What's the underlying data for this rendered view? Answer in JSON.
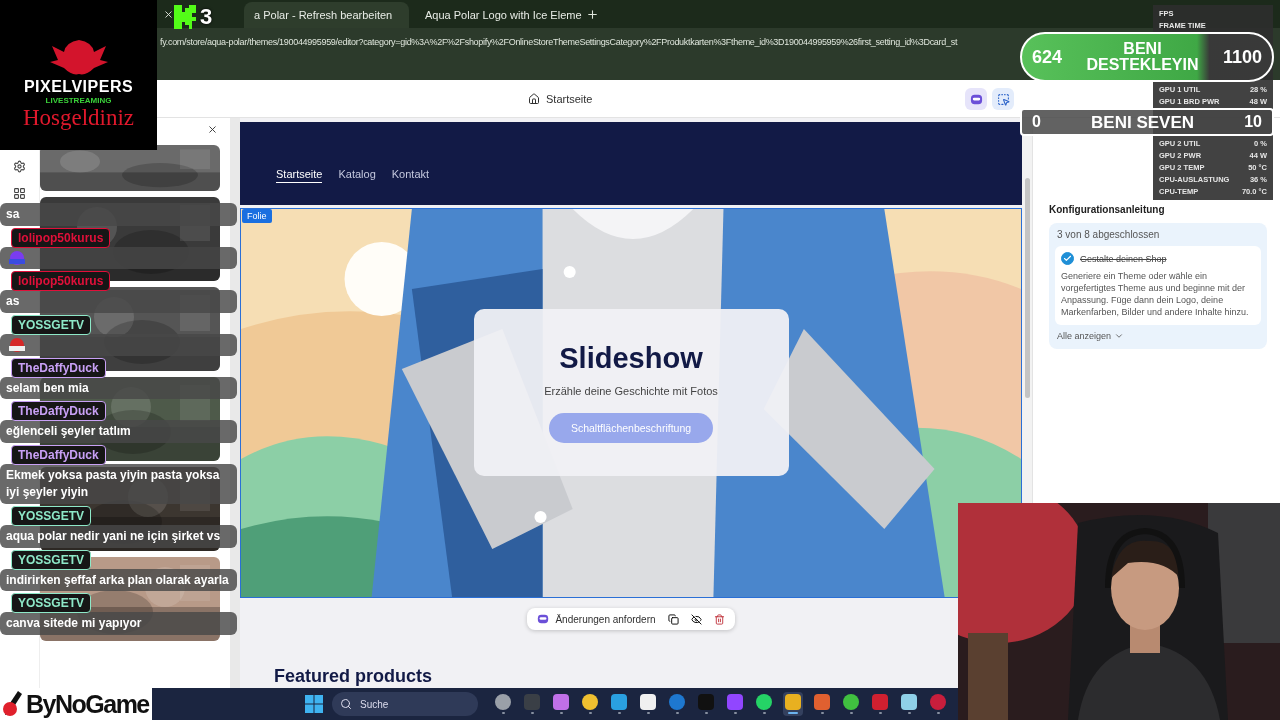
{
  "stream_logo": {
    "title": "PIXELVIPERS",
    "subtitle": "LIVESTREAMING",
    "greeting": "Hosgeldiniz"
  },
  "kick_badge": {
    "count": "3"
  },
  "browser": {
    "tabs": [
      {
        "title": "a Polar - Refresh bearbeiten",
        "selected": true
      },
      {
        "title": "Aqua Polar Logo with Ice Eleme",
        "selected": false
      }
    ],
    "url": "fy.com/store/aqua-polar/themes/190044995959/editor?category=gid%3A%2F%2Fshopify%2FOnlineStoreThemeSettingsCategory%2FProduktkarten%3Ftheme_id%3D190044995959%26first_setting_id%3Dcard_st"
  },
  "editor": {
    "page": "Startseite"
  },
  "preview": {
    "nav": [
      {
        "label": "Startseite",
        "selected": true
      },
      {
        "label": "Katalog",
        "selected": false
      },
      {
        "label": "Kontakt",
        "selected": false
      }
    ],
    "section_tag": "Folie",
    "slide": {
      "title": "Slideshow",
      "text": "Erzähle deine Geschichte mit Fotos",
      "button": "Schaltflächenbeschriftung"
    },
    "toolbar": {
      "label": "Änderungen anfordern"
    },
    "next_section": "Featured products"
  },
  "guide": {
    "title": "Konfigurationsanleitung",
    "progress": "3 von 8 abgeschlossen",
    "steps": [
      {
        "label": "Gestalte deinen Shop",
        "checked": true,
        "description": "Generiere ein Theme oder wähle ein vorgefertigtes Theme aus und beginne mit der Anpassung. Füge dann dein Logo, deine Markenfarben, Bilder und andere Inhalte hinzu."
      }
    ],
    "show_all": "Alle anzeigen"
  },
  "perf": [
    {
      "label": "FPS"
    },
    {
      "label": "FRAME TIME"
    },
    {
      "label": "GPU 1 UTIL",
      "value": "28 %"
    },
    {
      "label": "GPU 1 BRD PWR",
      "value": "48 W"
    },
    {
      "label": "GPU 2 UTIL",
      "value": "0 %"
    },
    {
      "label": "GPU 2 PWR",
      "value": "44 W"
    },
    {
      "label": "GPU 2 TEMP",
      "value": "50 °C"
    },
    {
      "label": "CPU-AUSLASTUNG",
      "value": "36 %"
    },
    {
      "label": "CPU-TEMP",
      "value": "70.0 °C"
    }
  ],
  "likes": {
    "count": "624",
    "label": "BENI DESTEKLEYIN",
    "goal": "1100"
  },
  "loves": {
    "count": "0",
    "label": "BENI SEVEN",
    "goal": "10"
  },
  "chat": [
    {
      "kind": "text",
      "text": "sa"
    },
    {
      "kind": "emote",
      "user": "lolipop50kurus",
      "color": "#e0103a"
    },
    {
      "kind": "text",
      "user": "lolipop50kurus",
      "color": "#e0103a",
      "text": "as"
    },
    {
      "kind": "emote",
      "user": "YOSSGETV",
      "color": "#8ee8c8"
    },
    {
      "kind": "text",
      "user": "TheDaffyDuck",
      "color": "#c8a0f5",
      "text": "selam ben mia"
    },
    {
      "kind": "text",
      "user": "TheDaffyDuck",
      "color": "#c8a0f5",
      "text": "eğlenceli şeyler tatlım"
    },
    {
      "kind": "text",
      "user": "TheDaffyDuck",
      "color": "#c8a0f5",
      "text": "Ekmek yoksa pasta yiyin pasta yoksa iyi şeyler yiyin"
    },
    {
      "kind": "text",
      "user": "YOSSGETV",
      "color": "#8ee8c8",
      "text": "aqua polar nedir yani ne için şirket vs"
    },
    {
      "kind": "text",
      "user": "YOSSGETV",
      "color": "#8ee8c8",
      "text": "indirirken şeffaf arka plan olarak ayarla"
    },
    {
      "kind": "text",
      "user": "YOSSGETV",
      "color": "#8ee8c8",
      "text": "canva sitede mi yapıyor"
    }
  ],
  "sponsor": {
    "name": "ByNoGame"
  },
  "taskbar": {
    "search": "Suche",
    "apps": [
      {
        "color": "#9aa0a8",
        "selected": false
      },
      {
        "color": "#3a3f46",
        "selected": false
      },
      {
        "color": "#c070e8",
        "selected": false
      },
      {
        "color": "#f0c030",
        "selected": false
      },
      {
        "color": "#2aa0e0",
        "selected": false
      },
      {
        "color": "#f0f0f0",
        "selected": false
      },
      {
        "color": "#1e78d0",
        "selected": false
      },
      {
        "color": "#111111",
        "selected": false
      },
      {
        "color": "#9146ff",
        "selected": false
      },
      {
        "color": "#25d366",
        "selected": false
      },
      {
        "color": "#e8b020",
        "selected": true
      },
      {
        "color": "#e06030",
        "selected": false
      },
      {
        "color": "#40c040",
        "selected": false
      },
      {
        "color": "#d02030",
        "selected": false
      },
      {
        "color": "#8fd0e8",
        "selected": false
      },
      {
        "color": "#c81e3c",
        "selected": false
      }
    ]
  }
}
